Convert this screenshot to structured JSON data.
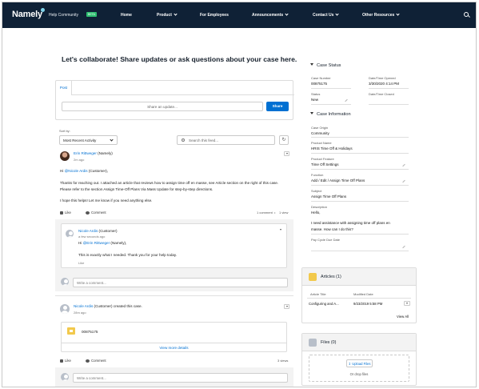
{
  "nav": {
    "logo": "Namely",
    "help_community": "Help Community",
    "badge": "BETA",
    "items": [
      {
        "label": "Home",
        "has_menu": false
      },
      {
        "label": "Product",
        "has_menu": true
      },
      {
        "label": "For Employees",
        "has_menu": false
      },
      {
        "label": "Announcements",
        "has_menu": true
      },
      {
        "label": "Contact Us",
        "has_menu": true
      },
      {
        "label": "Other Resources",
        "has_menu": true
      }
    ],
    "search_icon": "search-icon"
  },
  "heading": "Let's collaborate! Share updates or ask questions about your case here.",
  "publisher": {
    "tab": "Post",
    "placeholder": "Share an update...",
    "share_label": "Share"
  },
  "feed_controls": {
    "sort_label": "Sort by:",
    "sort_value": "Most Recent Activity",
    "search_placeholder": "Search this feed...",
    "refresh_icon": "refresh-icon"
  },
  "post1": {
    "author": "Erin Rittweger",
    "author_role": " (Namely)",
    "time": "2m ago",
    "greeting_prefix": "Hi ",
    "greeting_mention": "@Nicole Ardis",
    "greeting_suffix": " (Customer),",
    "paragraph1": "Thanks for reaching out. I attached an article that reviews how to assign time off en masse, see Article section on the right of this case. Please refer to the section Assign Time-Off Plans Via Mass Update for step-by-step directions.",
    "paragraph2": "I hope this helps! Let me know if you need anything else.",
    "like": "Like",
    "comment": "Comment",
    "comment_count": "1 comment",
    "views": "1 view"
  },
  "comment1": {
    "author": "Nicole Ardis",
    "author_role": " (Customer)",
    "time": "a few seconds ago",
    "greeting_prefix": "Hi ",
    "greeting_mention": "@Erin Rittweger",
    "greeting_suffix": " (Namely),",
    "text": "This is exactly what I needed. Thank you for your help today.",
    "like": "Like"
  },
  "write_comment": "Write a comment...",
  "post2": {
    "author": "Nicole Ardis",
    "author_suffix": " (Customer) created this case.",
    "time": "28m ago",
    "file_name": "00875175",
    "view_more": "View more details",
    "like": "Like",
    "comment": "Comment",
    "views": "3 views"
  },
  "case_status": {
    "title": "Case Status",
    "case_number_label": "Case Number",
    "case_number": "00875175",
    "opened_label": "Date/Time Opened",
    "opened": "3/30/2020 4:14 PM",
    "status_label": "Status",
    "status": "New",
    "closed_label": "Date/Time Closed",
    "closed": ""
  },
  "case_info": {
    "title": "Case Information",
    "origin_label": "Case Origin",
    "origin": "Community",
    "product_name_label": "Product Name",
    "product_name": "HRIS Time Off & Holidays",
    "product_feature_label": "Product Feature",
    "product_feature": "Time Off Settings",
    "function_label": "Function",
    "function": "Add / Edit / Assign Time Off Plans",
    "subject_label": "Subject",
    "subject": "Assign Time Off Plans",
    "description_label": "Description",
    "description_line1": "Hello,",
    "description_line2": "I need assistance with assigning time off plans en",
    "description_line3": "masse. How can I do this?",
    "pay_cycle_label": "Pay Cycle Due Date",
    "pay_cycle": ""
  },
  "articles": {
    "title": "Articles (1)",
    "col_title": "Article Title",
    "col_date": "Modified Date",
    "row_title": "Configuring and A...",
    "row_date": "9/23/2019 5:58 PM",
    "view_all": "View All",
    "icon_color": "#f2c94c"
  },
  "files": {
    "title": "Files (0)",
    "upload_label": "Upload Files",
    "drop_text": "Or drop files",
    "icon_color": "#b8bfc9"
  }
}
